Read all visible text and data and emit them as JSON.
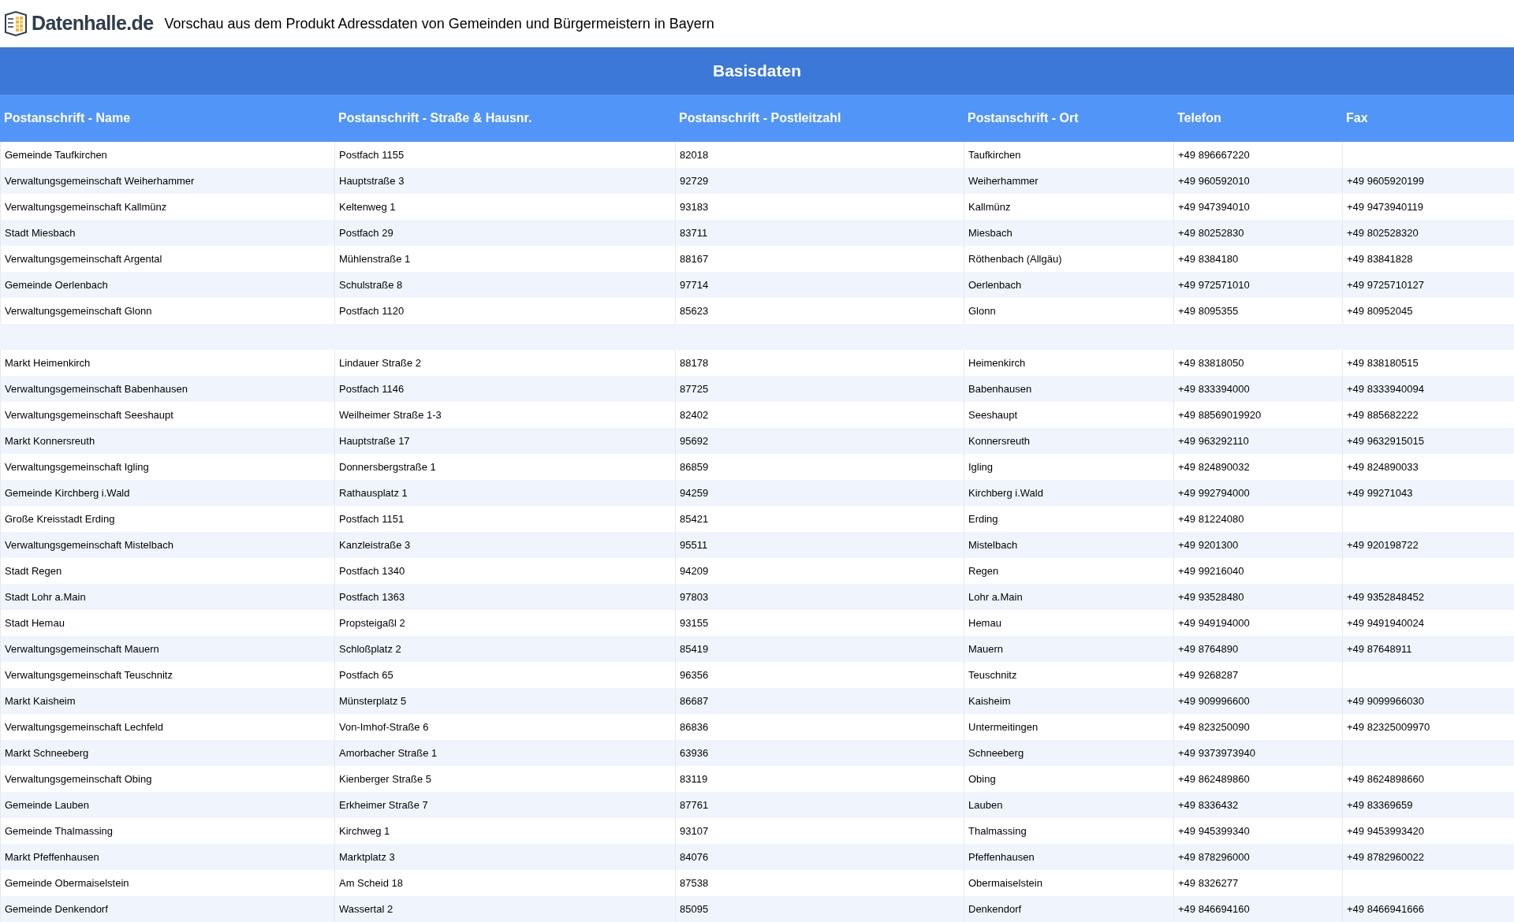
{
  "header": {
    "logo_text": "Datenhalle.de",
    "title": "Vorschau aus dem Produkt Adressdaten von Gemeinden und Bürgermeistern in Bayern"
  },
  "table": {
    "section_title": "Basisdaten",
    "columns": [
      "Postanschrift - Name",
      "Postanschrift - Straße & Hausnr.",
      "Postanschrift - Postleitzahl",
      "Postanschrift - Ort",
      "Telefon",
      "Fax"
    ],
    "rows": [
      {
        "kind": "data",
        "cells": [
          "Gemeinde Taufkirchen",
          "Postfach 1155",
          "82018",
          "Taufkirchen",
          "+49 896667220"
        ]
      },
      {
        "kind": "data",
        "cells": [
          "Verwaltungsgemeinschaft Weiherhammer",
          "Hauptstraße 3",
          "92729",
          "Weiherhammer",
          "+49 960592010",
          "+49 9605920199"
        ]
      },
      {
        "kind": "data",
        "cells": [
          "Verwaltungsgemeinschaft Kallmünz",
          "Keltenweg 1",
          "93183",
          "Kallmünz",
          "+49 947394010",
          "+49 9473940119"
        ]
      },
      {
        "kind": "data",
        "cells": [
          "Stadt Miesbach",
          "Postfach 29",
          "83711",
          "Miesbach",
          "+49 80252830",
          "+49 802528320"
        ]
      },
      {
        "kind": "data",
        "cells": [
          "Verwaltungsgemeinschaft Argental",
          "Mühlenstraße 1",
          "88167",
          "Röthenbach (Allgäu)",
          "+49 8384180",
          "+49 83841828"
        ]
      },
      {
        "kind": "data",
        "cells": [
          "Gemeinde Oerlenbach",
          "Schulstraße 8",
          "97714",
          "Oerlenbach",
          "+49 972571010",
          "+49 9725710127"
        ]
      },
      {
        "kind": "data",
        "cells": [
          "Verwaltungsgemeinschaft Glonn",
          "Postfach 1120",
          "85623",
          "Glonn",
          "+49 8095355",
          "+49 80952045"
        ]
      },
      {
        "kind": "blank"
      },
      {
        "kind": "data",
        "cells": [
          "Markt Heimenkirch",
          "Lindauer Straße 2",
          "88178",
          "Heimenkirch",
          "+49 83818050",
          "+49 838180515"
        ]
      },
      {
        "kind": "data",
        "cells": [
          "Verwaltungsgemeinschaft Babenhausen",
          "Postfach 1146",
          "87725",
          "Babenhausen",
          "+49 833394000",
          "+49 8333940094"
        ]
      },
      {
        "kind": "data",
        "cells": [
          "Verwaltungsgemeinschaft Seeshaupt",
          "Weilheimer Straße 1-3",
          "82402",
          "Seeshaupt",
          "+49 88569019920",
          "+49 885682222"
        ]
      },
      {
        "kind": "data",
        "cells": [
          "Markt Konnersreuth",
          "Hauptstraße 17",
          "95692",
          "Konnersreuth",
          "+49 963292110",
          "+49 9632915015"
        ]
      },
      {
        "kind": "data",
        "cells": [
          "Verwaltungsgemeinschaft Igling",
          "Donnersbergstraße 1",
          "86859",
          "Igling",
          "+49 824890032",
          "+49 824890033"
        ]
      },
      {
        "kind": "data",
        "cells": [
          "Gemeinde Kirchberg i.Wald",
          "Rathausplatz 1",
          "94259",
          "Kirchberg i.Wald",
          "+49 992794000",
          "+49 99271043"
        ]
      },
      {
        "kind": "data",
        "cells": [
          "Große Kreisstadt Erding",
          "Postfach 1151",
          "85421",
          "Erding",
          "+49 81224080"
        ]
      },
      {
        "kind": "data",
        "cells": [
          "Verwaltungsgemeinschaft Mistelbach",
          "Kanzleistraße 3",
          "95511",
          "Mistelbach",
          "+49 9201300",
          "+49 920198722"
        ]
      },
      {
        "kind": "data",
        "cells": [
          "Stadt Regen",
          "Postfach 1340",
          "94209",
          "Regen",
          "+49 99216040"
        ]
      },
      {
        "kind": "data",
        "cells": [
          "Stadt Lohr a.Main",
          "Postfach 1363",
          "97803",
          "Lohr a.Main",
          "+49 93528480",
          "+49 9352848452"
        ]
      },
      {
        "kind": "data",
        "cells": [
          "Stadt Hemau",
          "Propsteigaßl 2",
          "93155",
          "Hemau",
          "+49 949194000",
          "+49 9491940024"
        ]
      },
      {
        "kind": "data",
        "cells": [
          "Verwaltungsgemeinschaft Mauern",
          "Schloßplatz 2",
          "85419",
          "Mauern",
          "+49 8764890",
          "+49 87648911"
        ]
      },
      {
        "kind": "data",
        "cells": [
          "Verwaltungsgemeinschaft Teuschnitz",
          "Postfach 65",
          "96356",
          "Teuschnitz",
          "+49 9268287"
        ]
      },
      {
        "kind": "data",
        "cells": [
          "Markt Kaisheim",
          "Münsterplatz 5",
          "86687",
          "Kaisheim",
          "+49 909996600",
          "+49 9099966030"
        ]
      },
      {
        "kind": "data",
        "cells": [
          "Verwaltungsgemeinschaft Lechfeld",
          "Von-Imhof-Straße 6",
          "86836",
          "Untermeitingen",
          "+49 823250090",
          "+49 82325009970"
        ]
      },
      {
        "kind": "data",
        "cells": [
          "Markt Schneeberg",
          "Amorbacher Straße 1",
          "63936",
          "Schneeberg",
          "+49 9373973940"
        ]
      },
      {
        "kind": "data",
        "cells": [
          "Verwaltungsgemeinschaft Obing",
          "Kienberger Straße 5",
          "83119",
          "Obing",
          "+49 862489860",
          "+49 8624898660"
        ]
      },
      {
        "kind": "data",
        "cells": [
          "Gemeinde Lauben",
          "Erkheimer Straße 7",
          "87761",
          "Lauben",
          "+49 8336432",
          "+49 83369659"
        ]
      },
      {
        "kind": "data",
        "cells": [
          "Gemeinde Thalmassing",
          "Kirchweg 1",
          "93107",
          "Thalmassing",
          "+49 945399340",
          "+49 9453993420"
        ]
      },
      {
        "kind": "data",
        "cells": [
          "Markt Pfeffenhausen",
          "Marktplatz 3",
          "84076",
          "Pfeffenhausen",
          "+49 878296000",
          "+49 8782960022"
        ]
      },
      {
        "kind": "data",
        "cells": [
          "Gemeinde Obermaiselstein",
          "Am Scheid 18",
          "87538",
          "Obermaiselstein",
          "+49 8326277"
        ]
      },
      {
        "kind": "data",
        "cells": [
          "Gemeinde Denkendorf",
          "Wassertal 2",
          "85095",
          "Denkendorf",
          "+49 846694160",
          "+49 8466941666"
        ]
      }
    ]
  }
}
